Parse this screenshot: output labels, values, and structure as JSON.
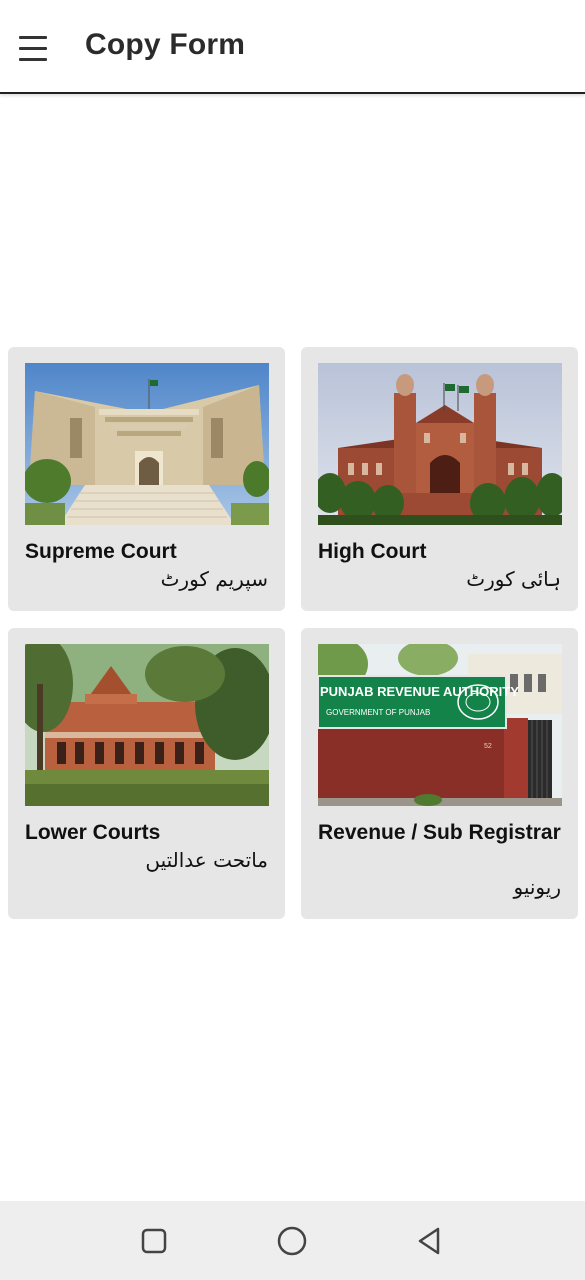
{
  "appbar": {
    "title": "Copy Form"
  },
  "cards": [
    {
      "title_en": "Supreme Court",
      "title_ur": "سپریم کورٹ"
    },
    {
      "title_en": "High Court",
      "title_ur": "ہائی کورٹ"
    },
    {
      "title_en": "Lower Courts",
      "title_ur": "ماتحت عدالتیں"
    },
    {
      "title_en": "Revenue / Sub Registrar",
      "title_ur": "ریونیو"
    }
  ],
  "revenue_photo": {
    "sign_line1": "PUNJAB REVENUE AUTHORITY",
    "sign_line2": "GOVERNMENT OF PUNJAB",
    "door_number": "52"
  },
  "navbar": {
    "icons": [
      "square-icon",
      "circle-icon",
      "triangle-back-icon"
    ]
  }
}
